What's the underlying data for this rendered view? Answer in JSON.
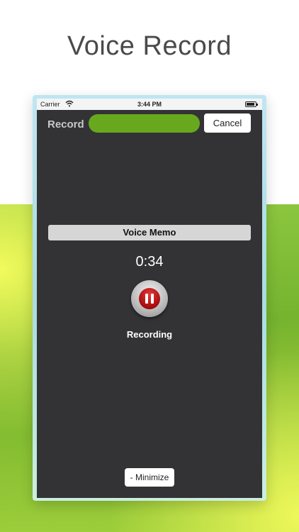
{
  "headline": "Voice Record",
  "status_bar": {
    "carrier": "Carrier",
    "time": "3:44 PM",
    "wifi_icon": "wifi-icon",
    "battery_icon": "battery-icon"
  },
  "record_screen": {
    "record_label": "Record",
    "cancel_label": "Cancel",
    "memo_title": "Voice Memo",
    "timer": "0:34",
    "pause_icon": "pause-icon",
    "status": "Recording",
    "minimize_label": "- Minimize"
  },
  "colors": {
    "accent_green": "#68a81e",
    "screen_bg": "#333335",
    "pause_red": "#b01214"
  }
}
